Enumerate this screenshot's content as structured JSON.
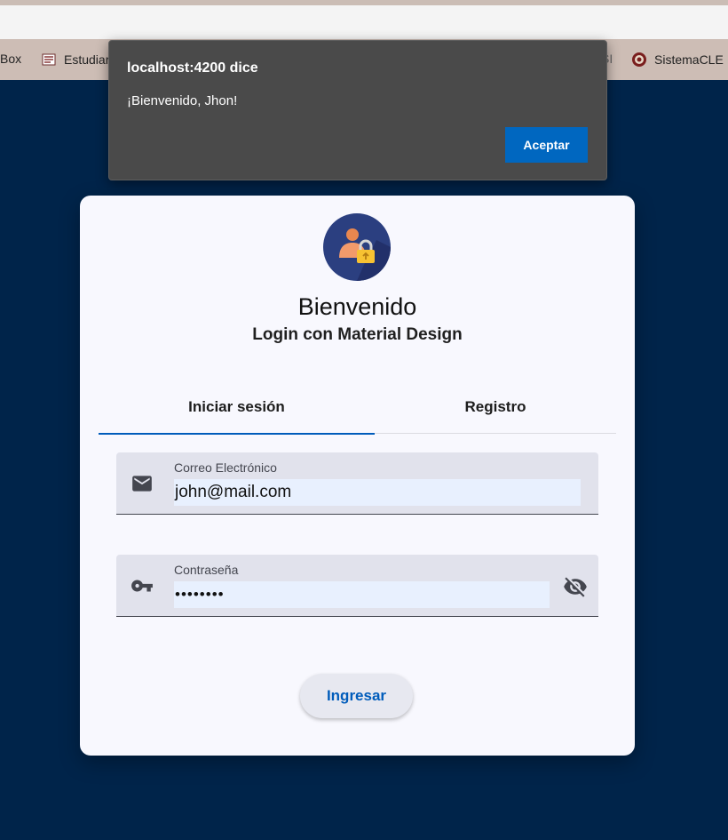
{
  "browser": {
    "bookmarks": [
      {
        "label": "Box",
        "icon": "box-icon"
      },
      {
        "label": "Estudiar",
        "icon": "estudiantes-icon"
      },
      {
        "label": "SI",
        "icon": ""
      },
      {
        "label": "SistemaCLE",
        "icon": "sistemacle-icon"
      }
    ]
  },
  "alert": {
    "title": "localhost:4200 dice",
    "message": "¡Bienvenido, Jhon!",
    "button": "Aceptar"
  },
  "login": {
    "avatar_icon": "user-lock-icon",
    "title": "Bienvenido",
    "subtitle": "Login con Material Design",
    "tabs": [
      {
        "label": "Iniciar sesión",
        "active": true
      },
      {
        "label": "Registro",
        "active": false
      }
    ],
    "email": {
      "label": "Correo Electrónico",
      "value": "john@mail.com",
      "icon": "mail-icon"
    },
    "password": {
      "label": "Contraseña",
      "value": "••••••••",
      "icon": "key-icon",
      "toggle_icon": "visibility-off-icon"
    },
    "submit": "Ingresar"
  },
  "colors": {
    "background": "#00244a",
    "primary": "#005cbb",
    "dialog": "#4a4a4a",
    "dialog_button": "#0067c0"
  }
}
